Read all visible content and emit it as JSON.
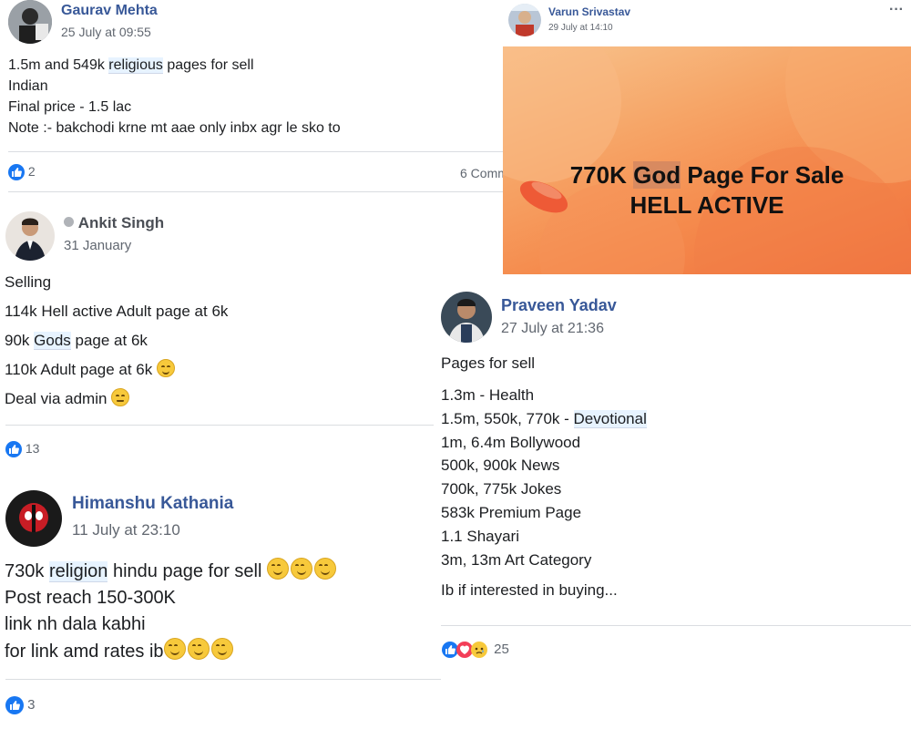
{
  "post1": {
    "author": "Gaurav Mehta",
    "time": "25 July at 09:55",
    "lines": [
      {
        "pre": "1.5m and 549k ",
        "hl": "religious",
        "post": " pages for sell"
      },
      {
        "pre": "Indian",
        "hl": "",
        "post": ""
      },
      {
        "pre": "Final price - 1.5 lac",
        "hl": "",
        "post": ""
      },
      {
        "pre": "Note :- bakchodi krne mt aae only inbx agr le sko to",
        "hl": "",
        "post": ""
      }
    ],
    "reactions": "2",
    "comments": "6 Comm"
  },
  "post2": {
    "author": "Varun Srivastav",
    "time": "29 July at 14:10",
    "more": "···",
    "banner_line1_pre": "770K ",
    "banner_line1_hl": "God",
    "banner_line1_post": " Page For Sale",
    "banner_line2": "HELL ACTIVE",
    "banner_colors": {
      "top": "#f7b57a",
      "mid": "#f58a4c",
      "bottom": "#f0703c"
    }
  },
  "post3": {
    "author": "Ankit Singh",
    "time": "31 January",
    "lines": [
      {
        "pre": "Selling",
        "hl": "",
        "post": ""
      },
      {
        "pre": "114k Hell active Adult page at 6k",
        "hl": "",
        "post": ""
      },
      {
        "pre": "90k ",
        "hl": "Gods",
        "post": " page at 6k"
      },
      {
        "pre": "110k Adult page at 6k ",
        "hl": "",
        "post": ""
      },
      {
        "pre": "Deal via admin ",
        "hl": "",
        "post": ""
      }
    ],
    "reactions": "13"
  },
  "post4": {
    "author": "Praveen Yadav",
    "time": "27 July at 21:36",
    "intro": "Pages for sell",
    "lines": [
      {
        "pre": "1.3m - Health",
        "hl": "",
        "post": ""
      },
      {
        "pre": "1.5m, 550k, 770k - ",
        "hl": "Devotional",
        "post": ""
      },
      {
        "pre": "1m, 6.4m Bollywood",
        "hl": "",
        "post": ""
      },
      {
        "pre": "500k, 900k News",
        "hl": "",
        "post": ""
      },
      {
        "pre": "700k, 775k Jokes",
        "hl": "",
        "post": ""
      },
      {
        "pre": "583k Premium Page",
        "hl": "",
        "post": ""
      },
      {
        "pre": "1.1 Shayari",
        "hl": "",
        "post": ""
      },
      {
        "pre": "3m, 13m Art Category",
        "hl": "",
        "post": ""
      }
    ],
    "outro": "Ib if interested in buying...",
    "reactions": "25"
  },
  "post5": {
    "author": "Himanshu Kathania",
    "time": "11 July at 23:10",
    "lines": [
      {
        "pre": "730k ",
        "hl": "religion",
        "post": " hindu page for sell "
      },
      {
        "pre": "Post reach 150-300K",
        "hl": "",
        "post": ""
      },
      {
        "pre": "link nh dala kabhi",
        "hl": "",
        "post": ""
      },
      {
        "pre": "for link amd rates ib",
        "hl": "",
        "post": ""
      }
    ],
    "reactions": "3"
  },
  "colors": {
    "name": "#385898",
    "like": "#1877f2",
    "love": "#f33e58",
    "highlight": "#e7f3ff"
  }
}
